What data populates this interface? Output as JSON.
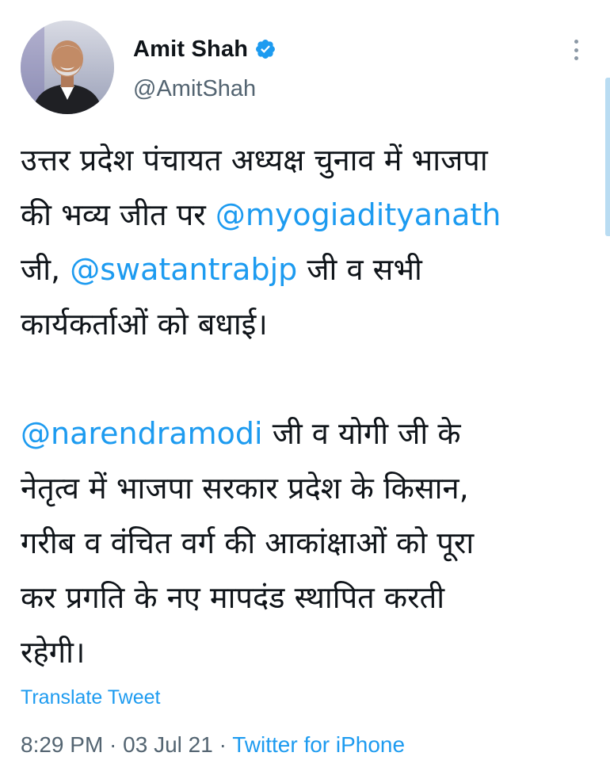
{
  "author": {
    "display_name": "Amit Shah",
    "handle": "@AmitShah",
    "verified": true
  },
  "tweet": {
    "para1": {
      "line1": "उत्तर प्रदेश पंचायत अध्यक्ष चुनाव में भाजपा",
      "line2_text": "की भव्य जीत पर ",
      "line2_mention": "@myogiadityanath",
      "line3_text_a": "जी, ",
      "line3_mention": "@swatantrabjp",
      "line3_text_b": " जी व सभी",
      "line4": "कार्यकर्ताओं को बधाई।"
    },
    "para2": {
      "line1_mention": "@narendramodi",
      "line1_text": " जी व योगी जी के",
      "line2": "नेतृत्व में भाजपा सरकार प्रदेश के किसान,",
      "line3": "गरीब व वंचित वर्ग की आकांक्षाओं को पूरा",
      "line4": "कर प्रगति के नए मापदंड स्थापित करती",
      "line5": "रहेगी।"
    }
  },
  "translate_label": "Translate Tweet",
  "meta": {
    "time": "8:29 PM",
    "separator1": " · ",
    "date": "03 Jul 21",
    "separator2": " · ",
    "source": "Twitter for iPhone"
  },
  "colors": {
    "link": "#1d9bf0",
    "secondary_text": "#536471",
    "primary_text": "#0f1419"
  },
  "icons": {
    "verified": "verified-badge-icon",
    "more": "more-vertical-icon"
  }
}
